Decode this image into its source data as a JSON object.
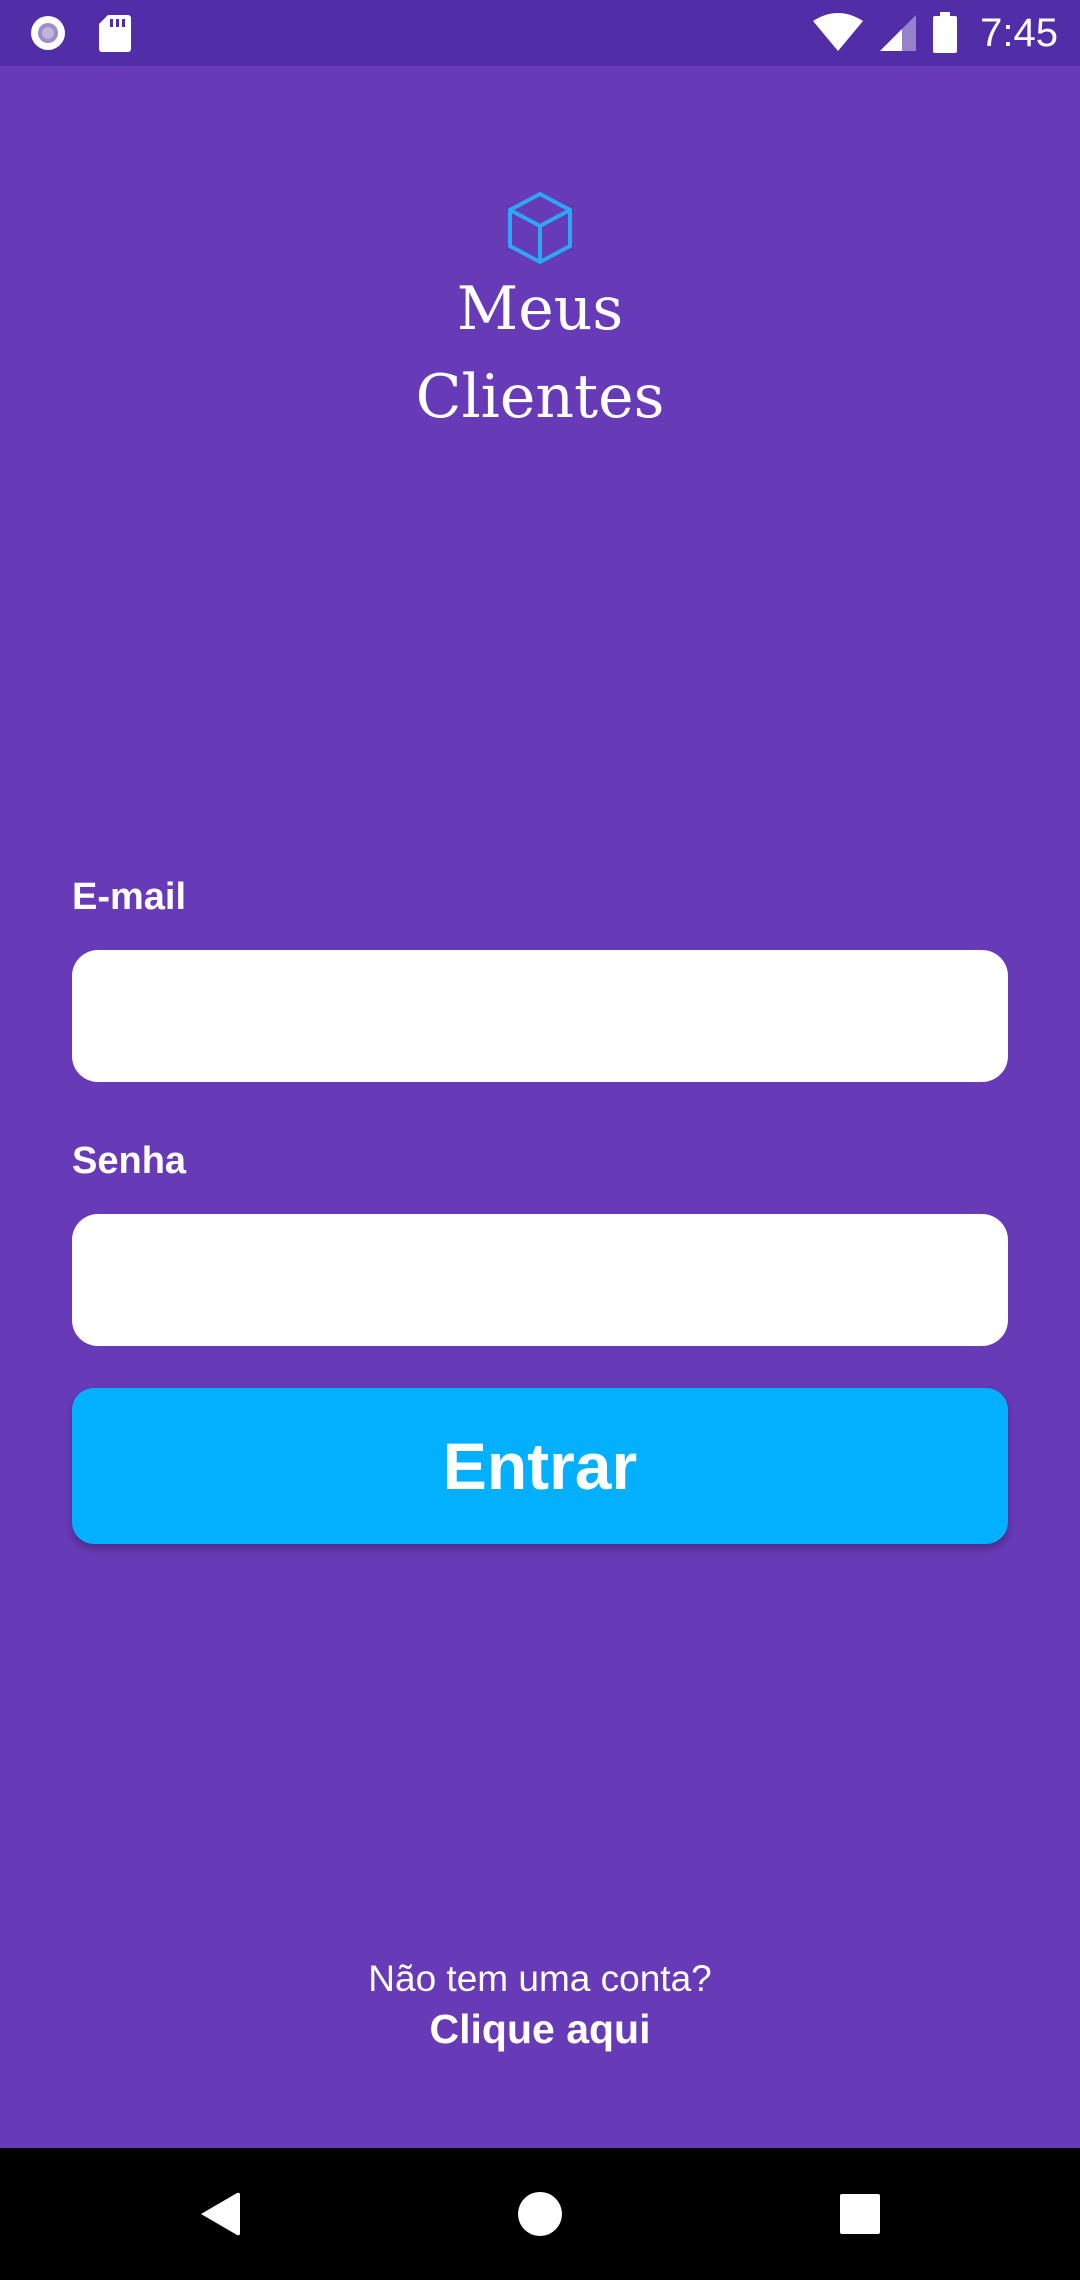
{
  "status_bar": {
    "time": "7:45",
    "icons": [
      "record-icon",
      "sd-card-icon",
      "wifi-icon",
      "cell-signal-icon",
      "battery-icon"
    ]
  },
  "app": {
    "name_line1": "Meus",
    "name_line2": "Clientes",
    "logo_icon": "cube-icon"
  },
  "form": {
    "email_label": "E-mail",
    "email_value": "",
    "password_label": "Senha",
    "password_value": "",
    "submit_label": "Entrar"
  },
  "signup": {
    "question": "Não tem uma conta?",
    "link": "Clique aqui"
  },
  "nav_bar": {
    "icons": [
      "back-icon",
      "home-icon",
      "recents-icon"
    ]
  },
  "colors": {
    "background": "#673ab7",
    "status_bar": "#512da8",
    "accent_button": "#03b0ff",
    "logo_icon": "#2ea6f6",
    "text": "#ffffff"
  }
}
